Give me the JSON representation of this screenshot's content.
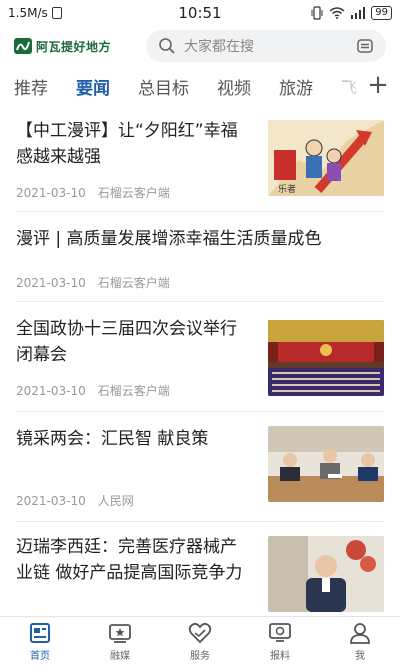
{
  "status_bar": {
    "speed": "1.5M/s",
    "time": "10:51",
    "battery": "99"
  },
  "header": {
    "logo_text": "阿瓦提好地方",
    "search_placeholder": "大家都在搜"
  },
  "tabs": [
    {
      "label": "推荐",
      "active": false
    },
    {
      "label": "要闻",
      "active": true
    },
    {
      "label": "总目标",
      "active": false
    },
    {
      "label": "视频",
      "active": false
    },
    {
      "label": "旅游",
      "active": false
    },
    {
      "label": "飞",
      "active": false
    }
  ],
  "add_tab_symbol": "+",
  "news": [
    {
      "title": "【中工漫评】让“夕阳红”幸福感越来越强",
      "date": "2021-03-10",
      "source": "石榴云客户端",
      "thumb": "cartoon-elderly-thumbnail"
    },
    {
      "title": "漫评 | 高质量发展增添幸福生活质量成色",
      "date": "2021-03-10",
      "source": "石榴云客户端",
      "thumb": ""
    },
    {
      "title": "全国政协十三届四次会议举行闭幕会",
      "date": "2021-03-10",
      "source": "石榴云客户端",
      "thumb": "conference-hall-thumbnail"
    },
    {
      "title": "镜采两会：汇民智 献良策",
      "date": "2021-03-10",
      "source": "人民网",
      "thumb": "meeting-room-thumbnail"
    },
    {
      "title": "迈瑞李西廷：完善医疗器械产业链 做好产品提高国际竞争力",
      "date": "",
      "source": "",
      "thumb": "speaker-portrait-thumbnail"
    }
  ],
  "bottom_nav": [
    {
      "label": "首页",
      "icon": "home-icon",
      "active": true
    },
    {
      "label": "融媒",
      "icon": "media-icon",
      "active": false
    },
    {
      "label": "服务",
      "icon": "service-icon",
      "active": false
    },
    {
      "label": "报料",
      "icon": "report-icon",
      "active": false
    },
    {
      "label": "我",
      "icon": "user-icon",
      "active": false
    }
  ],
  "colors": {
    "accent": "#1f5fa8",
    "logo_green": "#1b6a3a",
    "meta_gray": "#999999"
  }
}
